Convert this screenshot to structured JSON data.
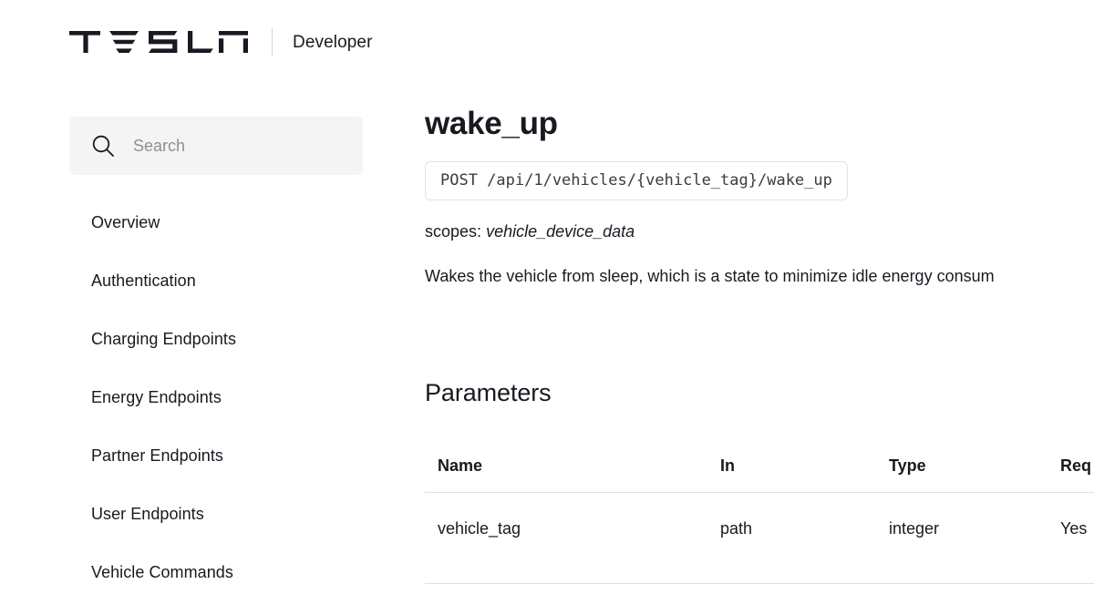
{
  "header": {
    "brand": "TESLA",
    "title": "Developer",
    "logo_icon": "tesla-wordmark"
  },
  "sidebar": {
    "search": {
      "icon": "search-icon",
      "value": "",
      "placeholder": "Search"
    },
    "items": [
      {
        "label": "Overview"
      },
      {
        "label": "Authentication"
      },
      {
        "label": "Charging Endpoints"
      },
      {
        "label": "Energy Endpoints"
      },
      {
        "label": "Partner Endpoints"
      },
      {
        "label": "User Endpoints"
      },
      {
        "label": "Vehicle Commands"
      }
    ]
  },
  "main": {
    "title": "wake_up",
    "endpoint": "POST /api/1/vehicles/{vehicle_tag}/wake_up",
    "scopes_label": "scopes:",
    "scopes_value": "vehicle_device_data",
    "description": "Wakes the vehicle from sleep, which is a state to minimize idle energy consum",
    "parameters_heading": "Parameters",
    "parameters_table": {
      "columns": [
        "Name",
        "In",
        "Type",
        "Req"
      ],
      "rows": [
        {
          "name": "vehicle_tag",
          "in": "path",
          "type": "integer",
          "required": "Yes"
        }
      ]
    }
  },
  "colors": {
    "background": "#ffffff",
    "text": "#171a20",
    "muted_text": "#5c5e62",
    "placeholder": "#8e8e93",
    "search_background": "#f4f4f4",
    "border": "#e0e0e0",
    "code_border": "#e3e3e3"
  }
}
